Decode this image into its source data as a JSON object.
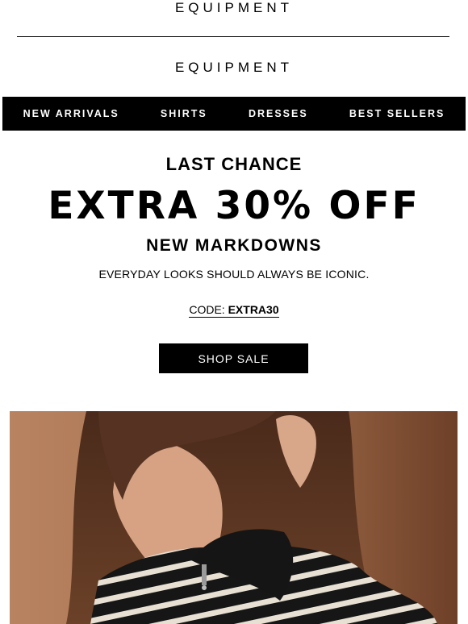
{
  "header": {
    "brand_top": "EQUIPMENT",
    "brand_logo": "EQUIPMENT"
  },
  "nav": {
    "items": [
      "NEW ARRIVALS",
      "SHIRTS",
      "DRESSES",
      "BEST SELLERS"
    ]
  },
  "promo": {
    "eyebrow": "LAST CHANCE",
    "headline": "EXTRA 30% OFF",
    "subheadline": "NEW MARKDOWNS",
    "tagline": "EVERYDAY LOOKS SHOULD ALWAYS BE ICONIC.",
    "code_label": "CODE:",
    "code_value": "EXTRA30",
    "cta_label": "SHOP SALE"
  },
  "hero": {
    "icon": "model-photo",
    "colors": {
      "background": "#b07a55",
      "hair": "#5a3523",
      "skin": "#d9a98a",
      "sweater_dark": "#151515",
      "sweater_light": "#e8e2d6"
    }
  }
}
